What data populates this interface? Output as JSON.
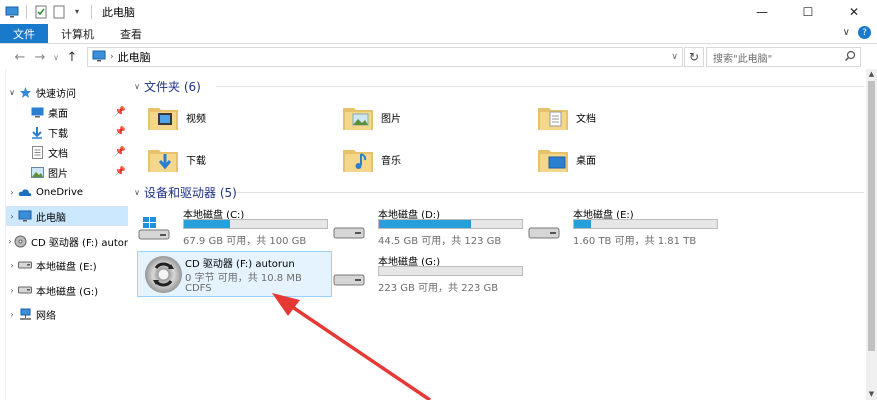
{
  "window": {
    "title": "此电脑",
    "minimize": "—",
    "maximize": "☐",
    "close": "✕"
  },
  "ribbon": {
    "tabs": [
      "文件",
      "计算机",
      "查看"
    ],
    "expand": "∨",
    "help": "?"
  },
  "address": {
    "crumb": "此电脑",
    "refresh": "↻",
    "search_placeholder": "搜索\"此电脑\""
  },
  "sidebar": {
    "items": [
      {
        "label": "快速访问",
        "icon": "star-icon"
      },
      {
        "label": "桌面",
        "icon": "desktop-icon",
        "pinned": true
      },
      {
        "label": "下载",
        "icon": "download-icon",
        "pinned": true
      },
      {
        "label": "文档",
        "icon": "document-icon",
        "pinned": true
      },
      {
        "label": "图片",
        "icon": "picture-icon",
        "pinned": true
      },
      {
        "label": "OneDrive",
        "icon": "cloud-icon"
      },
      {
        "label": "此电脑",
        "icon": "computer-icon"
      },
      {
        "label": "CD 驱动器 (F:) autor",
        "icon": "cd-icon"
      },
      {
        "label": "本地磁盘 (E:)",
        "icon": "disk-icon"
      },
      {
        "label": "本地磁盘 (G:)",
        "icon": "disk-icon"
      },
      {
        "label": "网络",
        "icon": "network-icon"
      }
    ],
    "selected": "此电脑"
  },
  "folders_group": {
    "header": "文件夹 (6)",
    "items": [
      {
        "label": "视频",
        "icon": "video-folder-icon"
      },
      {
        "label": "图片",
        "icon": "picture-folder-icon"
      },
      {
        "label": "文档",
        "icon": "document-folder-icon"
      },
      {
        "label": "下载",
        "icon": "download-folder-icon"
      },
      {
        "label": "音乐",
        "icon": "music-folder-icon"
      },
      {
        "label": "桌面",
        "icon": "desktop-folder-icon"
      }
    ]
  },
  "devices_group": {
    "header": "设备和驱动器 (5)",
    "drives": [
      {
        "name": "本地磁盘 (C:)",
        "info": "67.9 GB 可用，共 100 GB",
        "used_fraction": 0.32,
        "system": true
      },
      {
        "name": "本地磁盘 (D:)",
        "info": "44.5 GB 可用，共 123 GB",
        "used_fraction": 0.64
      },
      {
        "name": "本地磁盘 (E:)",
        "info": "1.60 TB 可用，共 1.81 TB",
        "used_fraction": 0.12
      },
      {
        "name": "本地磁盘 (G:)",
        "info": "223 GB 可用，共 223 GB",
        "used_fraction": 0.0
      }
    ],
    "cd": {
      "name": "CD 驱动器 (F:) autorun",
      "info": "0 字节 可用，共 10.8 MB",
      "fs": "CDFS"
    }
  },
  "colors": {
    "accent": "#1979ca",
    "bar_fill": "#26a0da",
    "group_header": "#1e3287",
    "selection": "#cce8ff",
    "annotation_arrow": "#e53935"
  }
}
